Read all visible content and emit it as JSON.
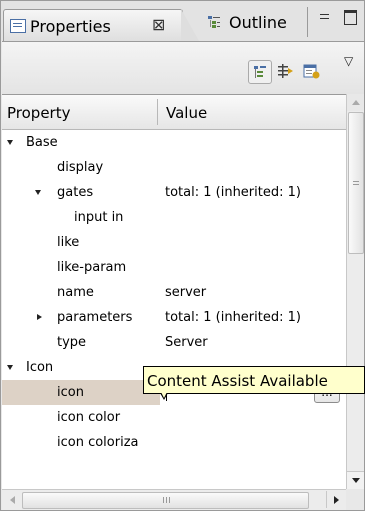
{
  "tabs": {
    "properties": {
      "label": "Properties",
      "close": "⊠",
      "icon": "properties-view-icon"
    },
    "outline": {
      "label": "Outline",
      "icon": "outline-view-icon"
    }
  },
  "window": {
    "minimize_icon": "minimize-icon",
    "maximize_icon": "maximize-icon"
  },
  "toolbar": {
    "buttons": [
      "show-categories-icon",
      "show-advanced-icon",
      "restore-default-icon"
    ],
    "view_menu": "▽"
  },
  "table": {
    "columns": [
      "Property",
      "Value"
    ],
    "rows": [
      {
        "name": "Base",
        "value": "",
        "level": 0,
        "expand": "open"
      },
      {
        "name": "display",
        "value": "",
        "level": 1
      },
      {
        "name": "gates",
        "value": "total: 1 (inherited: 1)",
        "level": 1,
        "expand": "open"
      },
      {
        "name": "input in",
        "value": "",
        "level": 2
      },
      {
        "name": "like",
        "value": "",
        "level": 1
      },
      {
        "name": "like-param",
        "value": "",
        "level": 1
      },
      {
        "name": "name",
        "value": "server",
        "level": 1
      },
      {
        "name": "parameters",
        "value": "total: 1 (inherited: 1)",
        "level": 1,
        "expand": "closed"
      },
      {
        "name": "type",
        "value": "Server",
        "level": 1
      },
      {
        "name": "Icon",
        "value": "",
        "level": 0,
        "expand": "open"
      },
      {
        "name": "icon",
        "value": "",
        "level": 1,
        "selected": true
      },
      {
        "name": "icon color",
        "value": "",
        "level": 1
      },
      {
        "name": "icon coloriza",
        "value": "",
        "level": 1
      }
    ]
  },
  "editor": {
    "browse_label": "...",
    "hint_icon": "lightbulb-icon"
  },
  "tooltip": {
    "text": "Content Assist Available"
  },
  "colors": {
    "selected_row": "#ddd2c6",
    "tooltip_bg": "#ffffcc"
  }
}
